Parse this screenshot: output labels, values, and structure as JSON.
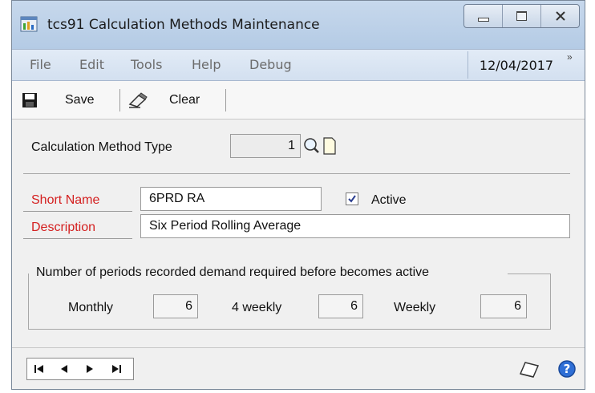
{
  "window": {
    "title": "tcs91 Calculation Methods Maintenance",
    "controls": {
      "minimize": "minimize-icon",
      "maximize": "maximize-icon",
      "close": "close-icon"
    }
  },
  "menu": {
    "items": [
      "File",
      "Edit",
      "Tools",
      "Help",
      "Debug"
    ],
    "date": "12/04/2017",
    "overflow": "»"
  },
  "toolbar": {
    "save_label": "Save",
    "clear_label": "Clear"
  },
  "form": {
    "calc_type_label": "Calculation Method Type",
    "calc_type_value": "1",
    "short_name_label": "Short Name",
    "short_name_value": "6PRD RA",
    "active_label": "Active",
    "active_checked": true,
    "description_label": "Description",
    "description_value": "Six Period Rolling Average"
  },
  "periods": {
    "legend": "Number of periods recorded demand required before becomes active",
    "monthly_label": "Monthly",
    "monthly_value": "6",
    "four_weekly_label": "4 weekly",
    "four_weekly_value": "6",
    "weekly_label": "Weekly",
    "weekly_value": "6"
  },
  "colors": {
    "required_label": "#d42020",
    "titlebar": "#b4cbe5",
    "menubar": "#d3e0f0",
    "window_bg": "#f0f0f0"
  }
}
